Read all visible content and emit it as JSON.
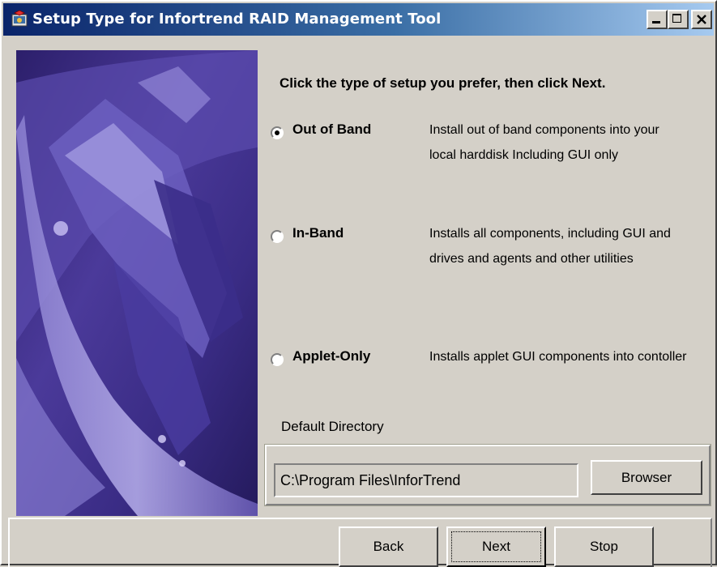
{
  "window": {
    "title": "Setup Type for Infortrend RAID Management Tool",
    "icon": "installer-icon",
    "controls": {
      "minimize": "_",
      "maximize": "□",
      "close": "X"
    }
  },
  "instruction": "Click the type of setup you prefer, then click Next.",
  "options": [
    {
      "label": "Out of Band",
      "selected": true,
      "description": "Install out of band components into your local harddisk Including GUI only"
    },
    {
      "label": "In-Band",
      "selected": false,
      "description": "Installs all components, including GUI and drives and agents and other utilities"
    },
    {
      "label": "Applet-Only",
      "selected": false,
      "description": "Installs applet GUI components into contoller"
    }
  ],
  "directory": {
    "label": "Default Directory",
    "value": "C:\\Program Files\\InforTrend",
    "browse_label": "Browser"
  },
  "buttons": {
    "back": "Back",
    "next": "Next",
    "stop": "Stop"
  },
  "colors": {
    "titlebar_start": "#0a246a",
    "titlebar_end": "#a6caf0",
    "face": "#d4d0c8",
    "image_tint": "#5a4a9e"
  }
}
